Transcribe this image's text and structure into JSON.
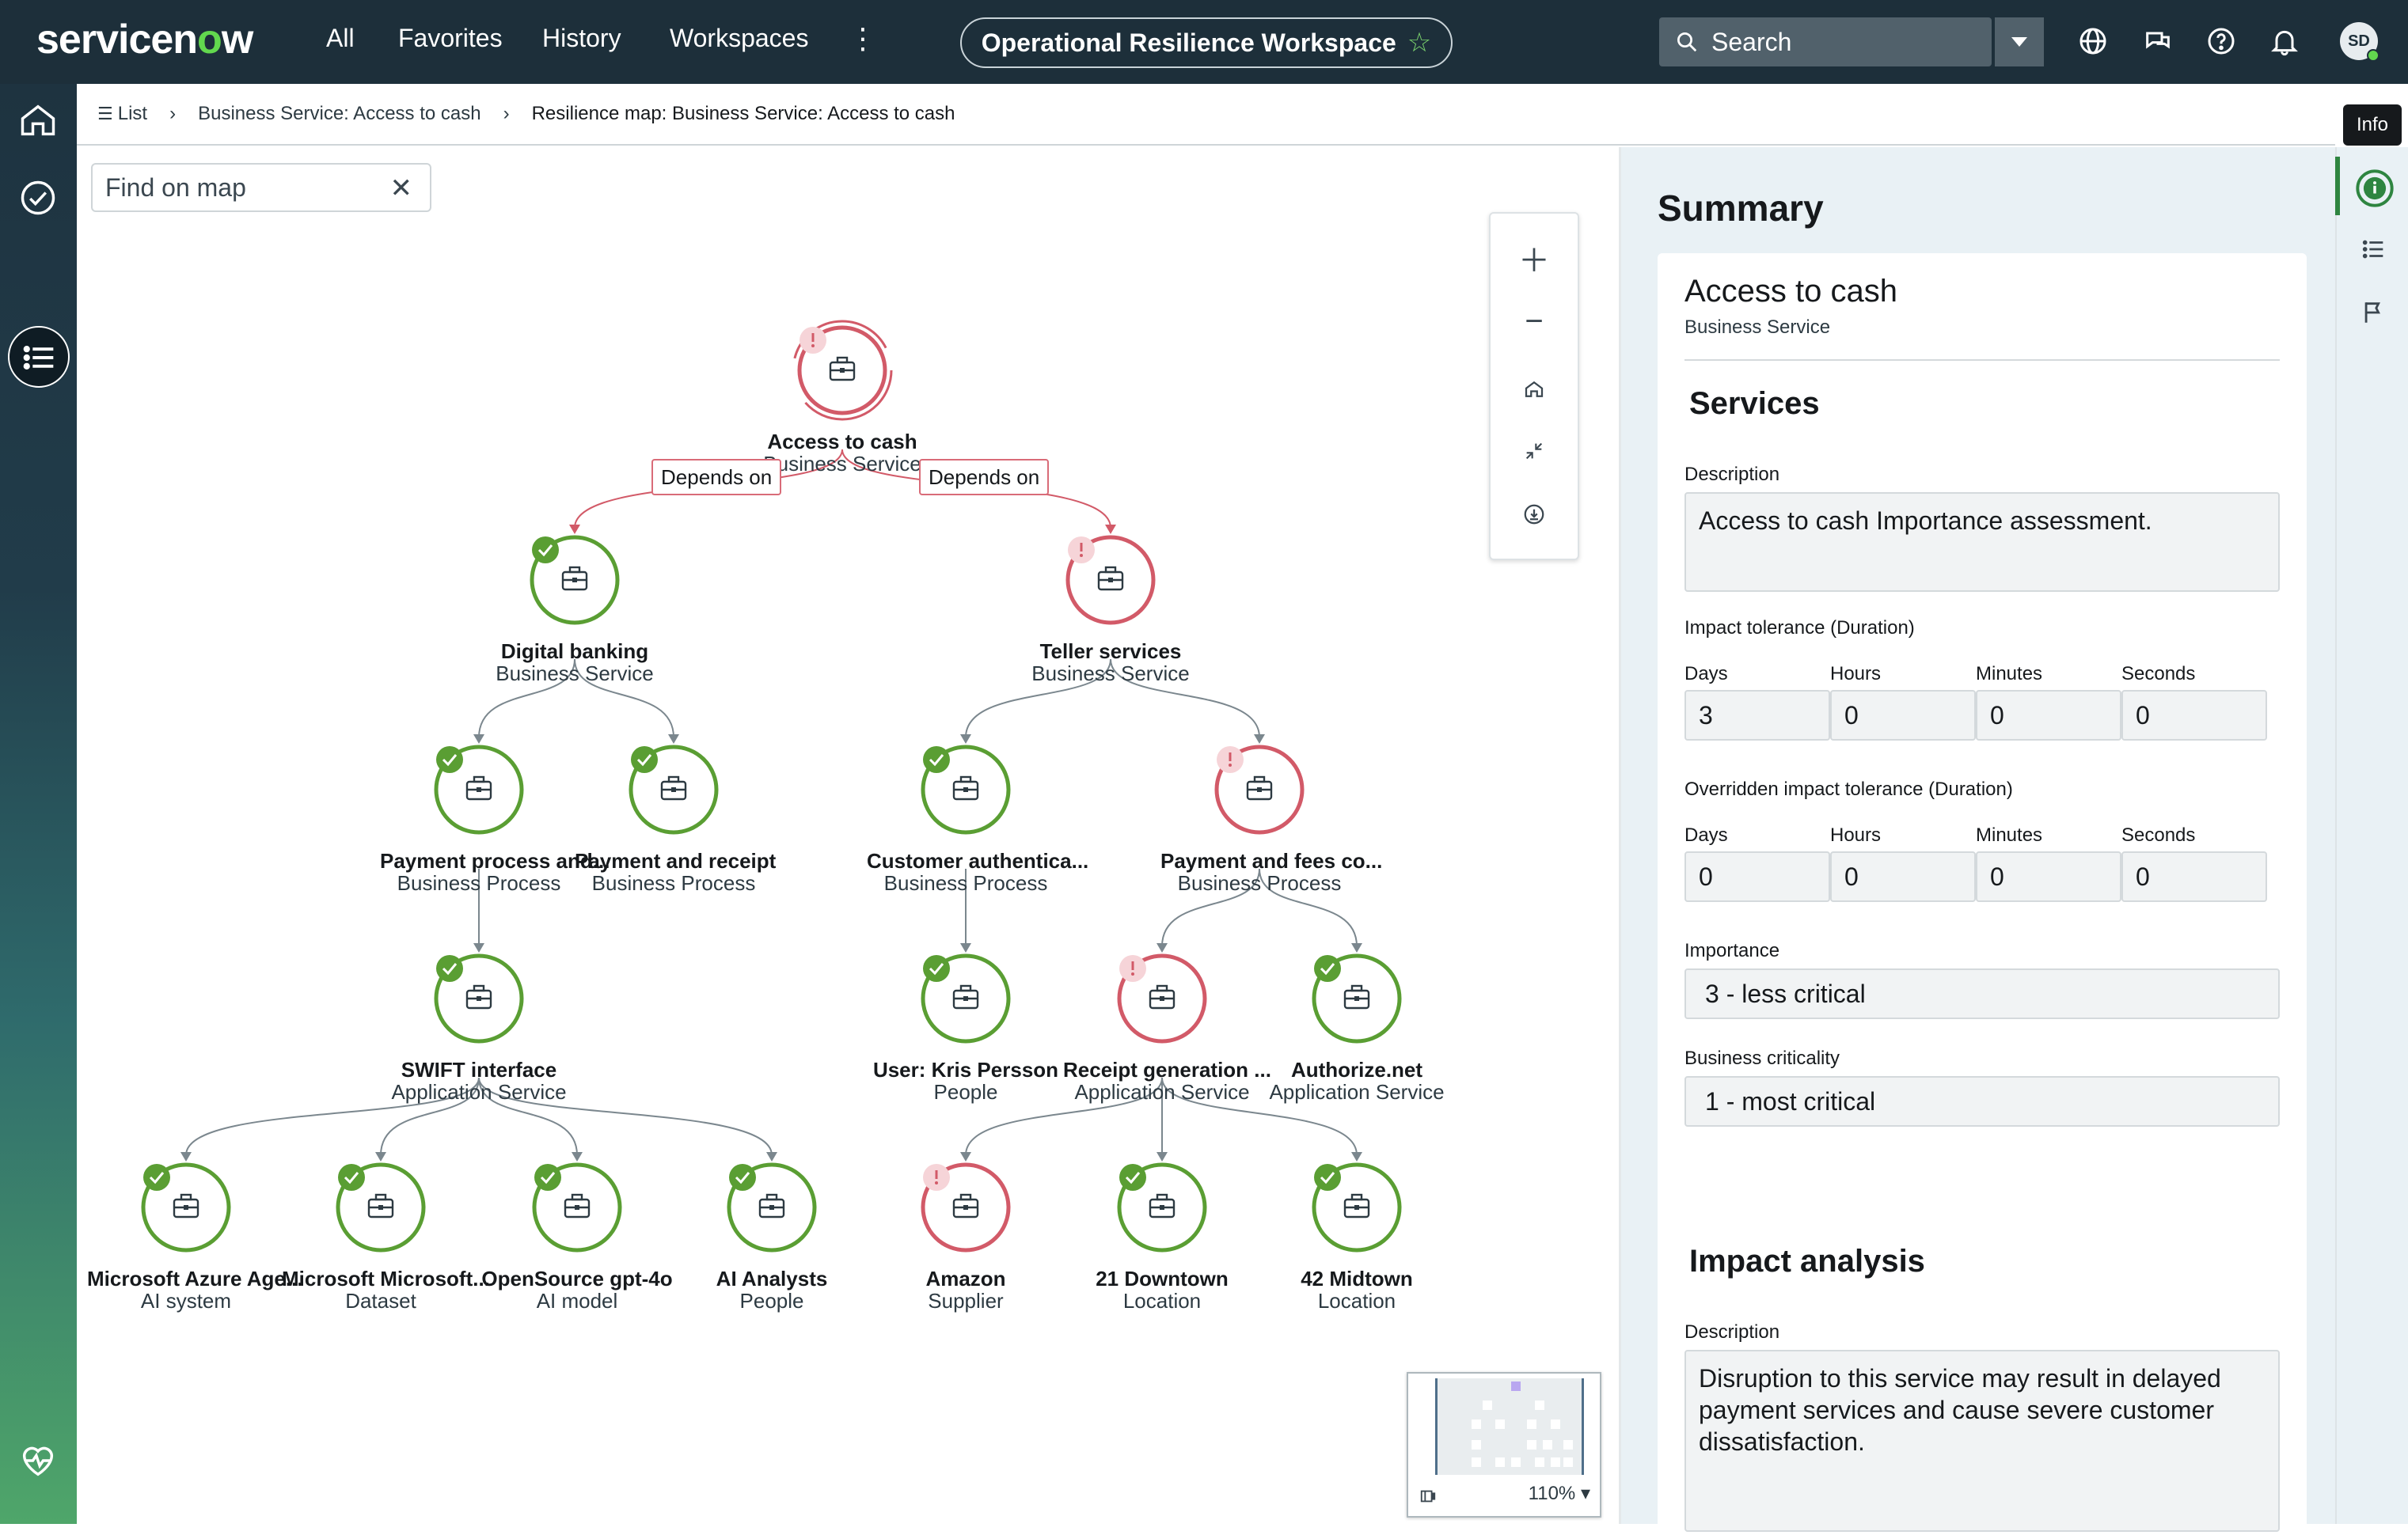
{
  "topbar": {
    "logo_prefix": "servicen",
    "logo_o": "o",
    "logo_suffix": "w",
    "nav": [
      "All",
      "Favorites",
      "History",
      "Workspaces"
    ],
    "kebab": "⋮",
    "workspace_title": "Operational Resilience Workspace",
    "search_label": "Search",
    "avatar_initials": "SD",
    "icons": [
      "globe-icon",
      "chat-icon",
      "help-icon",
      "bell-icon"
    ]
  },
  "breadcrumb": {
    "list_label": "List",
    "item1": "Business Service: Access to cash",
    "current": "Resilience map: Business Service: Access to cash",
    "separator": "›"
  },
  "tooltip": {
    "info": "Info"
  },
  "map": {
    "find_placeholder": "Find on map",
    "zoom_level": "110%",
    "depends_label": "Depends on",
    "accent_ok": "#5a9e33",
    "accent_alert": "#d25a68",
    "nodes": [
      {
        "id": "root",
        "title": "Access to cash",
        "subtitle": "Business Service",
        "status": "alert"
      },
      {
        "id": "digital",
        "title": "Digital banking",
        "subtitle": "Business Service",
        "status": "ok"
      },
      {
        "id": "teller",
        "title": "Teller services",
        "subtitle": "Business Service",
        "status": "alert"
      },
      {
        "id": "payproc",
        "title": "Payment process and...",
        "subtitle": "Business Process",
        "status": "ok"
      },
      {
        "id": "payrec",
        "title": "Payment and receipt",
        "subtitle": "Business Process",
        "status": "ok"
      },
      {
        "id": "custauth",
        "title": "Customer authentica...",
        "subtitle": "Business Process",
        "status": "ok"
      },
      {
        "id": "payfees",
        "title": "Payment and fees co...",
        "subtitle": "Business Process",
        "status": "alert"
      },
      {
        "id": "swift",
        "title": "SWIFT interface",
        "subtitle": "Application Service",
        "status": "ok"
      },
      {
        "id": "kris",
        "title": "User: Kris Persson",
        "subtitle": "People",
        "status": "ok"
      },
      {
        "id": "receipt",
        "title": "Receipt generation ...",
        "subtitle": "Application Service",
        "status": "alert"
      },
      {
        "id": "authnet",
        "title": "Authorize.net",
        "subtitle": "Application Service",
        "status": "ok"
      },
      {
        "id": "azure",
        "title": "Microsoft Azure Age...",
        "subtitle": "AI system",
        "status": "ok"
      },
      {
        "id": "msdata",
        "title": "Microsoft Microsoft...",
        "subtitle": "Dataset",
        "status": "ok"
      },
      {
        "id": "gpt",
        "title": "OpenSource gpt-4o",
        "subtitle": "AI model",
        "status": "ok"
      },
      {
        "id": "analysts",
        "title": "AI Analysts",
        "subtitle": "People",
        "status": "ok"
      },
      {
        "id": "amazon",
        "title": "Amazon",
        "subtitle": "Supplier",
        "status": "alert"
      },
      {
        "id": "downtown",
        "title": "21 Downtown",
        "subtitle": "Location",
        "status": "ok"
      },
      {
        "id": "midtown",
        "title": "42 Midtown",
        "subtitle": "Location",
        "status": "ok"
      }
    ]
  },
  "summary": {
    "heading": "Summary",
    "name": "Access to cash",
    "type": "Business Service",
    "services_heading": "Services",
    "description_label": "Description",
    "description": "Access to cash Importance assessment.",
    "impact_tolerance_label": "Impact tolerance (Duration)",
    "overridden_label": "Overridden impact tolerance (Duration)",
    "duration_labels": [
      "Days",
      "Hours",
      "Minutes",
      "Seconds"
    ],
    "impact_tolerance": [
      "3",
      "0",
      "0",
      "0"
    ],
    "overridden": [
      "0",
      "0",
      "0",
      "0"
    ],
    "importance_label": "Importance",
    "importance": "3 - less critical",
    "criticality_label": "Business criticality",
    "criticality": "1 - most critical",
    "impact_heading": "Impact analysis",
    "impact_description_label": "Description",
    "impact_description": "Disruption to this service may result in delayed payment services and cause severe customer dissatisfaction."
  }
}
